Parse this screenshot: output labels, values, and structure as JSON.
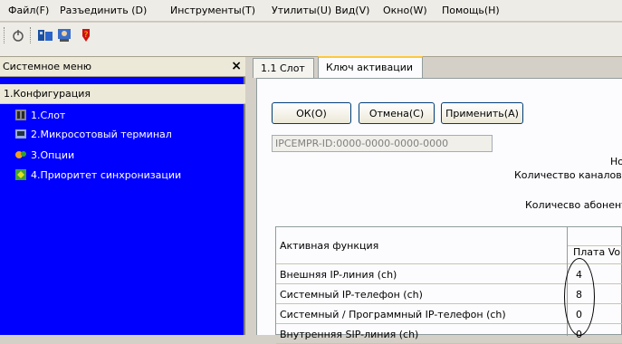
{
  "menubar": {
    "items": [
      "Файл(F)",
      "Разъединить (D)",
      "Инструменты(T)",
      "Утилиты(U)",
      "Вид(V)",
      "Окно(W)",
      "Помощь(H)"
    ]
  },
  "toolbar": {
    "icons": [
      "connect-icon",
      "device-icon",
      "user-icon",
      "help-icon"
    ]
  },
  "left_panel": {
    "title": "Системное меню",
    "close": "×",
    "config": "1.Конфигурация",
    "items": [
      "1.Слот",
      "2.Микросотовый терминал",
      "3.Опции",
      "4.Приоритет синхронизации"
    ]
  },
  "tabs": [
    "1.1 Слот",
    "Ключ активации"
  ],
  "buttons": {
    "ok": "ОК(O)",
    "cancel": "Отмена(C)",
    "apply": "Применить(A)"
  },
  "id_field": "IPCEMPR-ID:0000-0000-0000-0000",
  "labels": {
    "no": "Но",
    "channels": "Количество каналов",
    "subscribers": "Количесво абонент"
  },
  "table": {
    "header_label": "Активная функция",
    "header_col": "Плата Vo",
    "rows": [
      {
        "label": "Внешняя IP-линия (ch)",
        "value": "4"
      },
      {
        "label": "Системный IP-телефон (ch)",
        "value": "8"
      },
      {
        "label": "Системный / Программный IP-телефон (ch)",
        "value": "0"
      },
      {
        "label": "Внутренняя SIP-линия (ch)",
        "value": "0"
      }
    ]
  },
  "colors": {
    "tree_bg": "#0000ff",
    "tab_accent": "#ffc83c"
  }
}
